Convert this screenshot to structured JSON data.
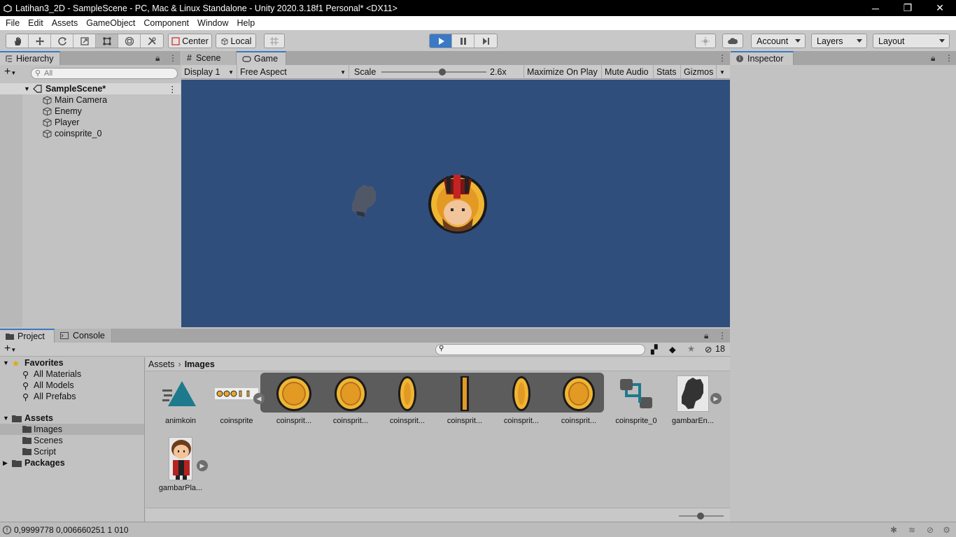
{
  "window": {
    "title": "Latihan3_2D - SampleScene - PC, Mac & Linux Standalone - Unity 2020.3.18f1 Personal* <DX11>",
    "controls": [
      "─",
      "❐",
      "✕"
    ]
  },
  "menu": [
    "File",
    "Edit",
    "Assets",
    "GameObject",
    "Component",
    "Window",
    "Help"
  ],
  "toolbar": {
    "pivot_label": "Center",
    "space_label": "Local",
    "account_label": "Account",
    "layers_label": "Layers",
    "layout_label": "Layout"
  },
  "hierarchy": {
    "tab_label": "Hierarchy",
    "search_placeholder": "All",
    "scene_name": "SampleScene*",
    "objects": [
      "Main Camera",
      "Enemy",
      "Player",
      "coinsprite_0"
    ]
  },
  "center": {
    "tabs": [
      "Scene",
      "Game"
    ],
    "active_tab": "Game",
    "display": "Display 1",
    "aspect": "Free Aspect",
    "scale_label": "Scale",
    "scale_value": "2.6x",
    "scale_fraction": 0.58,
    "options": [
      "Maximize On Play",
      "Mute Audio",
      "Stats",
      "Gizmos"
    ],
    "background_color": "#304e7c"
  },
  "inspector": {
    "tab_label": "Inspector"
  },
  "project": {
    "tabs": [
      "Project",
      "Console"
    ],
    "hidden_count": "18",
    "favorites_label": "Favorites",
    "favorites": [
      "All Materials",
      "All Models",
      "All Prefabs"
    ],
    "assets_label": "Assets",
    "asset_folders": [
      "Images",
      "Scenes",
      "Script"
    ],
    "selected_folder": "Images",
    "packages_label": "Packages",
    "breadcrumb": [
      "Assets",
      "Images"
    ],
    "items": [
      {
        "label": "animkoin",
        "icon": "animation-clip-icon"
      },
      {
        "label": "coinsprite",
        "icon": "sprite-sheet-icon"
      },
      {
        "label": "coinsprit...",
        "icon": "coin-sprite-icon"
      },
      {
        "label": "coinsprit...",
        "icon": "coin-sprite-icon"
      },
      {
        "label": "coinsprit...",
        "icon": "coin-sprite-icon"
      },
      {
        "label": "coinsprit...",
        "icon": "coin-sprite-icon"
      },
      {
        "label": "coinsprit...",
        "icon": "coin-sprite-icon"
      },
      {
        "label": "coinsprit...",
        "icon": "coin-sprite-icon"
      },
      {
        "label": "coinsprite_0",
        "icon": "animator-controller-icon"
      },
      {
        "label": "gambarEn...",
        "icon": "enemy-sprite-icon"
      },
      {
        "label": "gambarPla...",
        "icon": "player-sprite-icon"
      }
    ]
  },
  "status": {
    "message": "0,9999778 0,006660251 1 010"
  },
  "colors": {
    "accent": "#3a79c5",
    "play_button": "#3a79c5",
    "coin": "#e6a72a"
  }
}
